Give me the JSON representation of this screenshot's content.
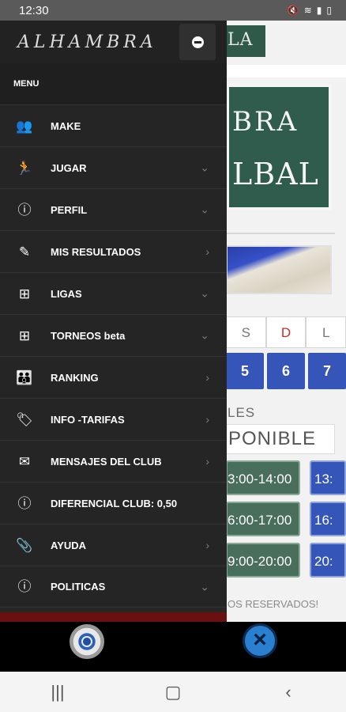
{
  "status_bar": {
    "time": "12:30",
    "icons": [
      "mute-icon",
      "wifi-icon",
      "signal-icon",
      "battery-icon"
    ]
  },
  "background_page": {
    "logo_fragment": "LA",
    "board_line1": "BRA",
    "board_line2": "LBAL",
    "day_headers": [
      "S",
      "D",
      "L"
    ],
    "day_dates": [
      "5",
      "6",
      "7"
    ],
    "section_label": "LES",
    "availability_label": "PONIBLE",
    "slots": [
      {
        "time": "3:00-14:00",
        "next": "13:"
      },
      {
        "time": "6:00-17:00",
        "next": "16:"
      },
      {
        "time": "9:00-20:00",
        "next": "20:"
      }
    ],
    "footer_text": "OS RESERVADOS!"
  },
  "drawer": {
    "logo": "ALHAMBRA",
    "menu_title": "MENU",
    "items": [
      {
        "label": "MAKE",
        "icon": "users-icon",
        "arrow": ""
      },
      {
        "label": "JUGAR",
        "icon": "runner-icon",
        "arrow": "⌄"
      },
      {
        "label": "PERFIL",
        "icon": "info-icon",
        "arrow": "⌄"
      },
      {
        "label": "MIS RESULTADOS",
        "icon": "pencil-icon",
        "arrow": "›"
      },
      {
        "label": "LIGAS",
        "icon": "bracket-icon",
        "arrow": "⌄"
      },
      {
        "label": "TORNEOS beta",
        "icon": "bracket-icon",
        "arrow": "⌄"
      },
      {
        "label": "RANKING",
        "icon": "group-icon",
        "arrow": "›"
      },
      {
        "label": "INFO -TARIFAS",
        "icon": "tag-icon",
        "arrow": "›"
      },
      {
        "label": "MENSAJES DEL CLUB",
        "icon": "envelope-icon",
        "arrow": "›"
      },
      {
        "label": "DIFERENCIAL CLUB: 0,50",
        "icon": "info-icon",
        "arrow": ""
      },
      {
        "label": "AYUDA",
        "icon": "paperclip-icon",
        "arrow": "›"
      },
      {
        "label": "POLITICAS",
        "icon": "info-icon",
        "arrow": "⌄"
      }
    ]
  },
  "bottom_bar": {
    "left_icon": "settings-gear-icon",
    "right_icon": "close-x-icon"
  },
  "nav_bar": {
    "recents_glyph": "|||",
    "home_glyph": "▢",
    "back_glyph": "‹"
  }
}
